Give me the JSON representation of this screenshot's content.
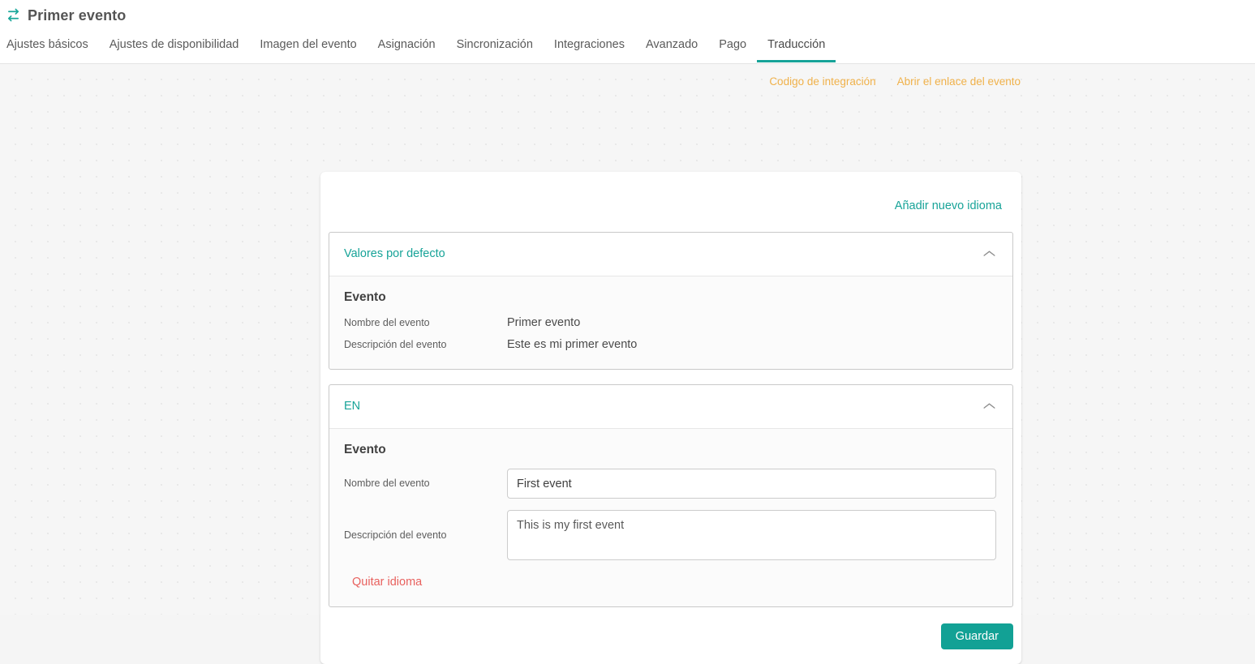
{
  "header": {
    "icon": "swap-icon",
    "title": "Primer evento",
    "tabs": [
      {
        "label": "Ajustes básicos",
        "active": false
      },
      {
        "label": "Ajustes de disponibilidad",
        "active": false
      },
      {
        "label": "Imagen del evento",
        "active": false
      },
      {
        "label": "Asignación",
        "active": false
      },
      {
        "label": "Sincronización",
        "active": false
      },
      {
        "label": "Integraciones",
        "active": false
      },
      {
        "label": "Avanzado",
        "active": false
      },
      {
        "label": "Pago",
        "active": false
      },
      {
        "label": "Traducción",
        "active": true
      }
    ]
  },
  "toplinks": [
    {
      "label": "Codigo de integración"
    },
    {
      "label": "Abrir el enlace del evento"
    }
  ],
  "card": {
    "add_language_label": "Añadir nuevo idioma",
    "default_panel": {
      "header_label": "Valores por defecto",
      "collapse_icon": "chevron-up-icon",
      "section_title": "Evento",
      "fields": [
        {
          "label": "Nombre del evento",
          "value": "Primer evento"
        },
        {
          "label": "Descripción del evento",
          "value": "Este es mi primer evento"
        }
      ]
    },
    "language_panel": {
      "header_label": "EN",
      "collapse_icon": "chevron-up-icon",
      "section_title": "Evento",
      "name_label": "Nombre del evento",
      "name_value": "First event",
      "description_label": "Descripción del evento",
      "description_value": "This is my first event",
      "remove_language_label": "Quitar idioma"
    },
    "save_label": "Guardar"
  },
  "colors": {
    "accent_teal": "#17a398",
    "link_orange": "#f0b14a",
    "danger_red": "#e8615e",
    "button_teal": "#12a195"
  }
}
